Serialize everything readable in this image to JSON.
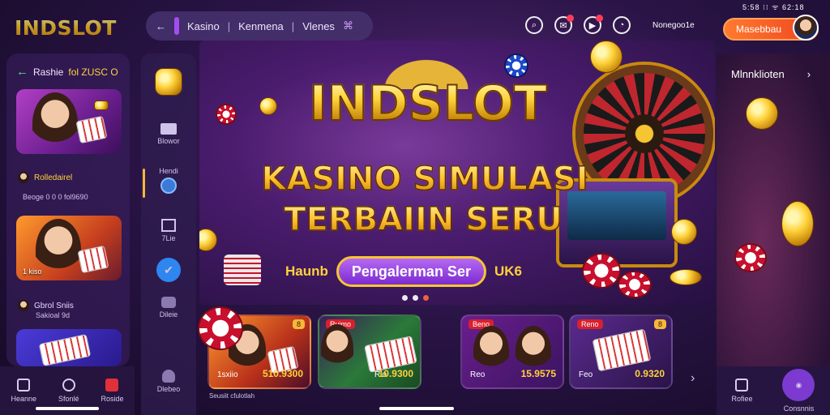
{
  "brand": {
    "logo": "INDSLOT"
  },
  "status_bar": {
    "text": "5:58 ⁝⁝ ᯤ 62:18"
  },
  "top_bar": {
    "back": "←",
    "search_parts": [
      "Kasino",
      "Kenmena",
      "Vlenes"
    ],
    "account_small": "Nonegoo1e",
    "login_label": "Masebbau"
  },
  "left_panel": {
    "header_prefix": "Rashie",
    "header_highlight": "fol ZUSC O",
    "card_a_label": "",
    "row1_name": "Rolledairel",
    "row1_sub": "Beoge 0 0 0 fol9690",
    "card_b_label": "1 kiso",
    "row2_name": "Gbrol Sniis",
    "row2_sub": "Sakioal 9d"
  },
  "left_nav": [
    {
      "label": "Heanne",
      "icon": "grid-icon"
    },
    {
      "label": "Sfonlé",
      "icon": "game-icon"
    },
    {
      "label": "Roside",
      "icon": "gift-icon"
    }
  ],
  "rail": [
    {
      "label": "",
      "icon": "pot-icon"
    },
    {
      "label": "Blowor",
      "icon": "card-icon"
    },
    {
      "label": "Hendi",
      "icon": "spin-icon"
    },
    {
      "label": "7Lie",
      "icon": "slot-icon"
    },
    {
      "label": "",
      "icon": "chat-icon"
    },
    {
      "label": "Dileie",
      "icon": "dice-icon"
    },
    {
      "label": "Dlebeo",
      "icon": "user-icon"
    }
  ],
  "hero": {
    "title": "INDSLOT",
    "subtitle1": "KASINO SIMULASI",
    "subtitle2": "TERBAIIN SERU",
    "cta_prefix": "Haunb",
    "cta_label": "Pengalerman Ser",
    "cta_suffix": "UK6"
  },
  "right_panel": {
    "label": "Mlnnklioten",
    "arrow": "›"
  },
  "right_nav": [
    {
      "label": "Rofiee",
      "icon": "home-icon"
    },
    {
      "label": "Consnnis",
      "icon": "profile-icon"
    }
  ],
  "games": [
    {
      "badge": "",
      "badge_gold": "8",
      "name": "1sxiio",
      "value": "510.9300"
    },
    {
      "badge": "Ruimo",
      "badge_gold": "",
      "name": "Rio",
      "value": "10.9300"
    },
    {
      "badge": "Beno",
      "badge_gold": "",
      "name": "Reo",
      "value": "15.9575"
    },
    {
      "badge": "Reno",
      "badge_gold": "8",
      "name": "Feo",
      "value": "0.9320"
    }
  ],
  "games_sub": "Seusiit cfulotlah",
  "games_next": "›",
  "colors": {
    "accent": "#f6c531",
    "login": "#f0451f",
    "primary": "#7c3ad0"
  }
}
